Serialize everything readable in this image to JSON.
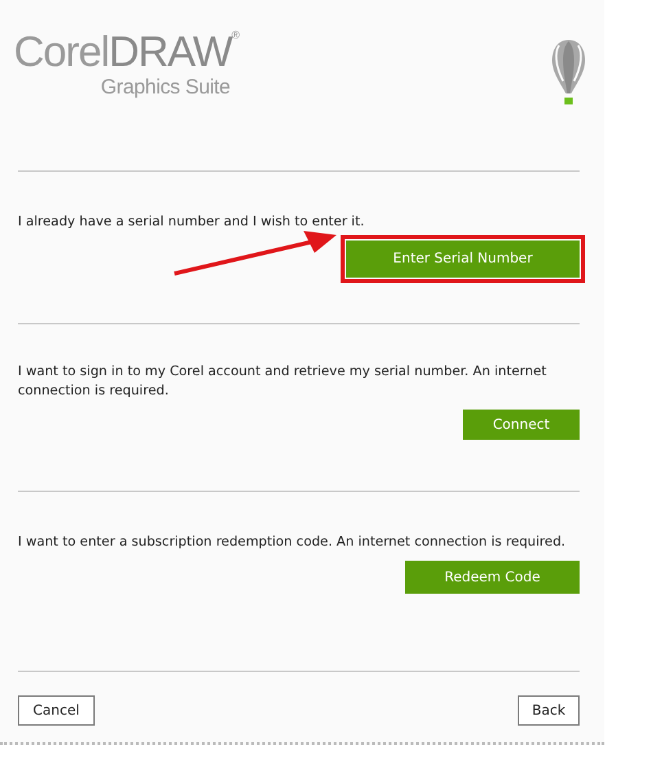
{
  "logo": {
    "brand_light": "Corel",
    "brand_bold": "DRAW",
    "trademark": "®",
    "subtitle": "Graphics Suite"
  },
  "options": [
    {
      "text": "I already have a serial number and I wish to enter it.",
      "button": "Enter Serial Number",
      "highlighted": true
    },
    {
      "text": "I want to sign in to my Corel account and retrieve my serial number. An internet connection is required.",
      "button": "Connect",
      "highlighted": false
    },
    {
      "text": "I want to enter a subscription redemption code. An internet connection is required.",
      "button": "Redeem Code",
      "highlighted": false
    }
  ],
  "footer": {
    "cancel": "Cancel",
    "back": "Back"
  }
}
